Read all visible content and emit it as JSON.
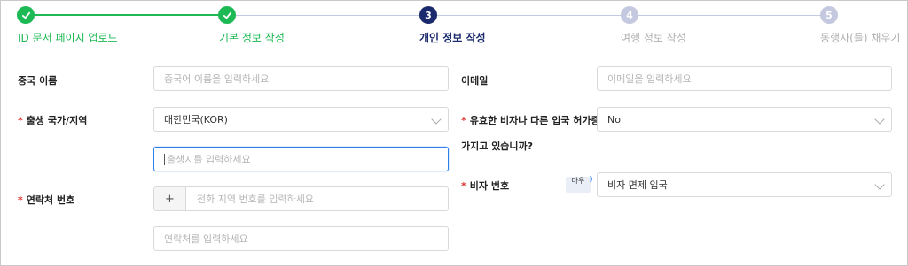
{
  "stepper": {
    "steps": [
      {
        "number": "",
        "label": "ID 문서 페이지 업로드",
        "state": "done"
      },
      {
        "number": "",
        "label": "기본 정보 작성",
        "state": "done"
      },
      {
        "number": "3",
        "label": "개인 정보 작성",
        "state": "current"
      },
      {
        "number": "4",
        "label": "여행 정보 작성",
        "state": "upcoming"
      },
      {
        "number": "5",
        "label": "동행자(들) 채우기",
        "state": "upcoming"
      }
    ],
    "colors": {
      "done": "#1db954",
      "current": "#1a2a6c",
      "upcoming": "#c5c9df"
    }
  },
  "form": {
    "chinese_name": {
      "label": "중국 이름",
      "placeholder": "중국어 이름을 입력하세요"
    },
    "email": {
      "label": "이메일",
      "placeholder": "이메일을 입력하세요"
    },
    "birth_country": {
      "label": "출생 국가/지역",
      "value": "대한민국(KOR)",
      "required_mark": "*"
    },
    "birthplace": {
      "placeholder": "출생지를 입력하세요"
    },
    "valid_visa": {
      "label_line1": "유효한 비자나 다른 입국 허가증을",
      "label_line2": "가지고 있습니까?",
      "value": "No",
      "required_mark": "*"
    },
    "phone": {
      "label": "연락처 번호",
      "prefix": "+",
      "area_placeholder": "전화 지역 번호를 입력하세요",
      "number_placeholder": "연락처를 입력하세요",
      "required_mark": "*"
    },
    "visa_number": {
      "label": "비자 번호",
      "value": "비자 면제 입국",
      "required_mark": "*",
      "tooltip_text": "마우"
    }
  }
}
